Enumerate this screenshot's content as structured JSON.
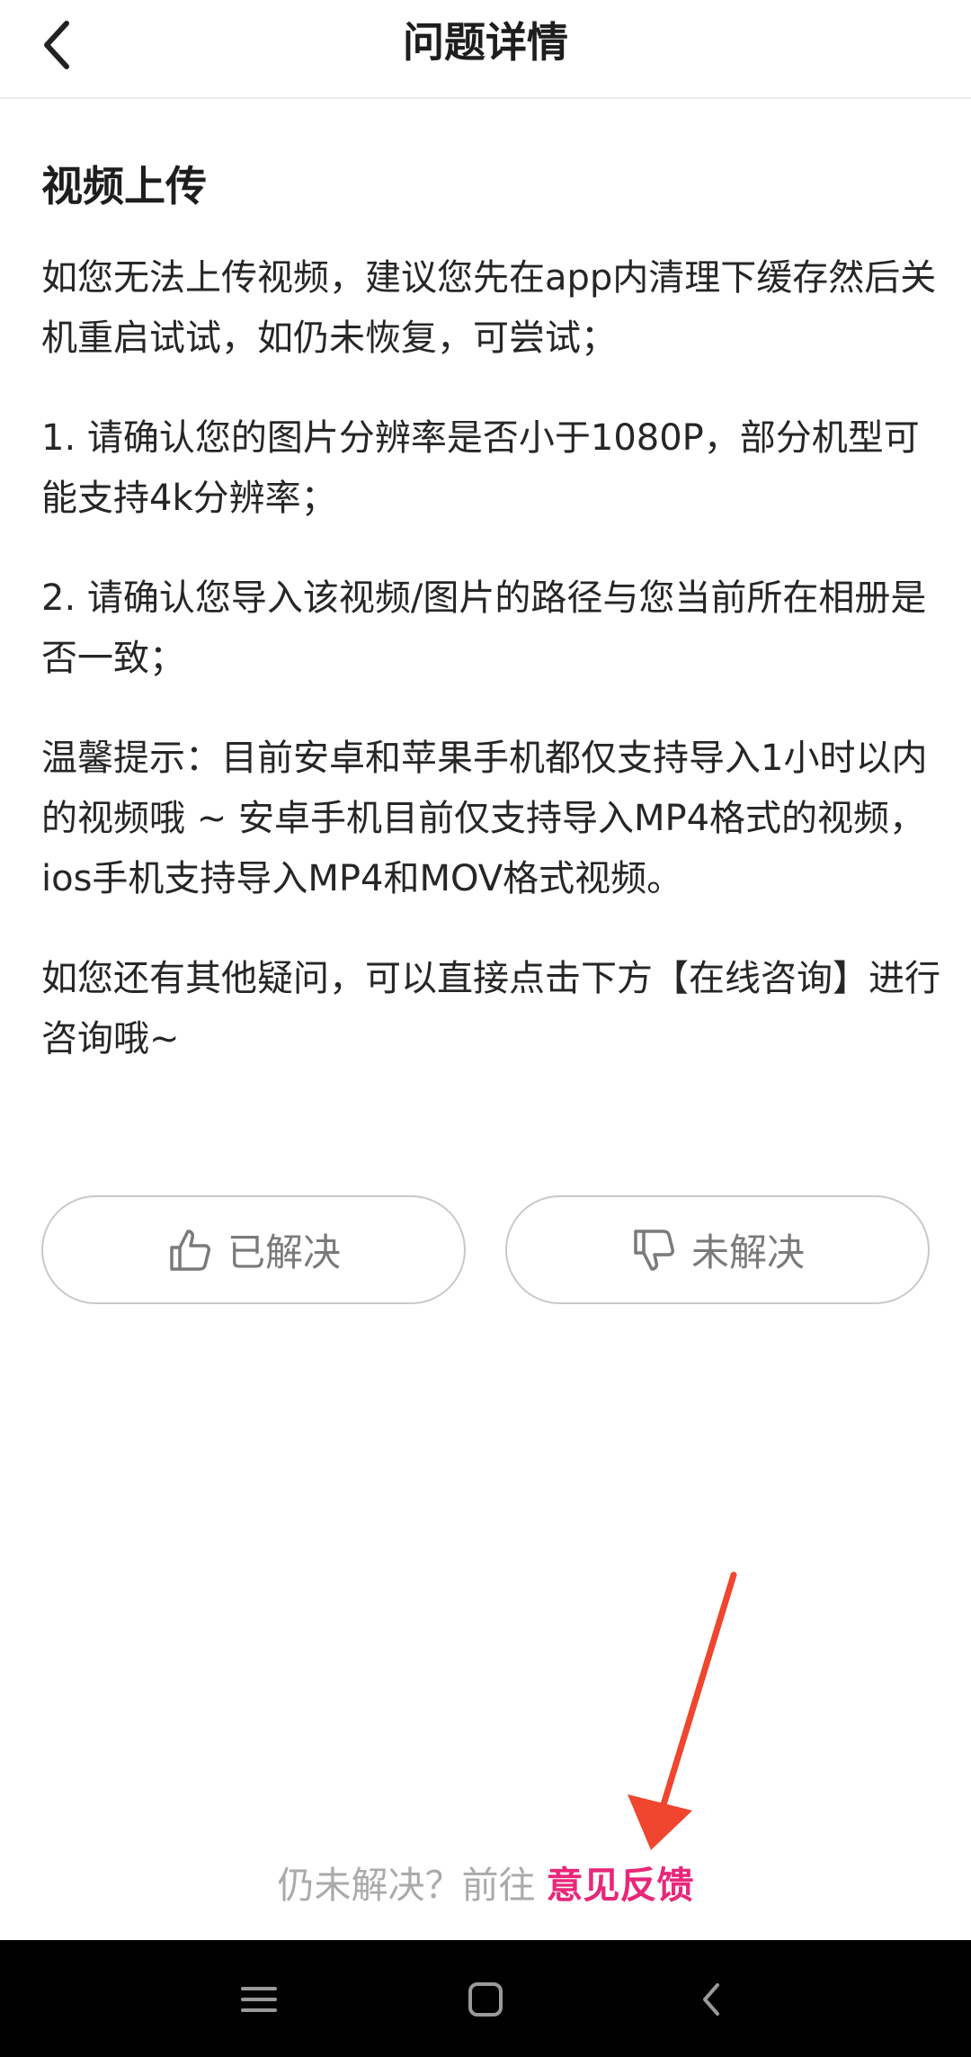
{
  "header": {
    "title": "问题详情",
    "back_icon": "chevron-left-icon"
  },
  "article": {
    "title": "视频上传",
    "paragraphs": [
      "如您无法上传视频，建议您先在app内清理下缓存然后关机重启试试，如仍未恢复，可尝试；",
      "1. 请确认您的图片分辨率是否小于1080P，部分机型可能支持4k分辨率；",
      "2. 请确认您导入该视频/图片的路径与您当前所在相册是否一致；",
      "温馨提示：目前安卓和苹果手机都仅支持导入1小时以内的视频哦 ~ 安卓手机目前仅支持导入MP4格式的视频，ios手机支持导入MP4和MOV格式视频。",
      "如您还有其他疑问，可以直接点击下方【在线咨询】进行咨询哦~"
    ]
  },
  "feedback": {
    "resolved_label": "已解决",
    "unresolved_label": "未解决",
    "resolved_icon": "thumbs-up-icon",
    "unresolved_icon": "thumbs-down-icon"
  },
  "footer": {
    "prefix": "仍未解决？前往",
    "link_label": "意见反馈",
    "link_color": "#e8277a",
    "annotation_arrow_color": "#f0452e"
  },
  "system_nav": {
    "menu_icon": "menu-icon",
    "home_icon": "home-square-icon",
    "back_icon": "back-triangle-icon"
  }
}
